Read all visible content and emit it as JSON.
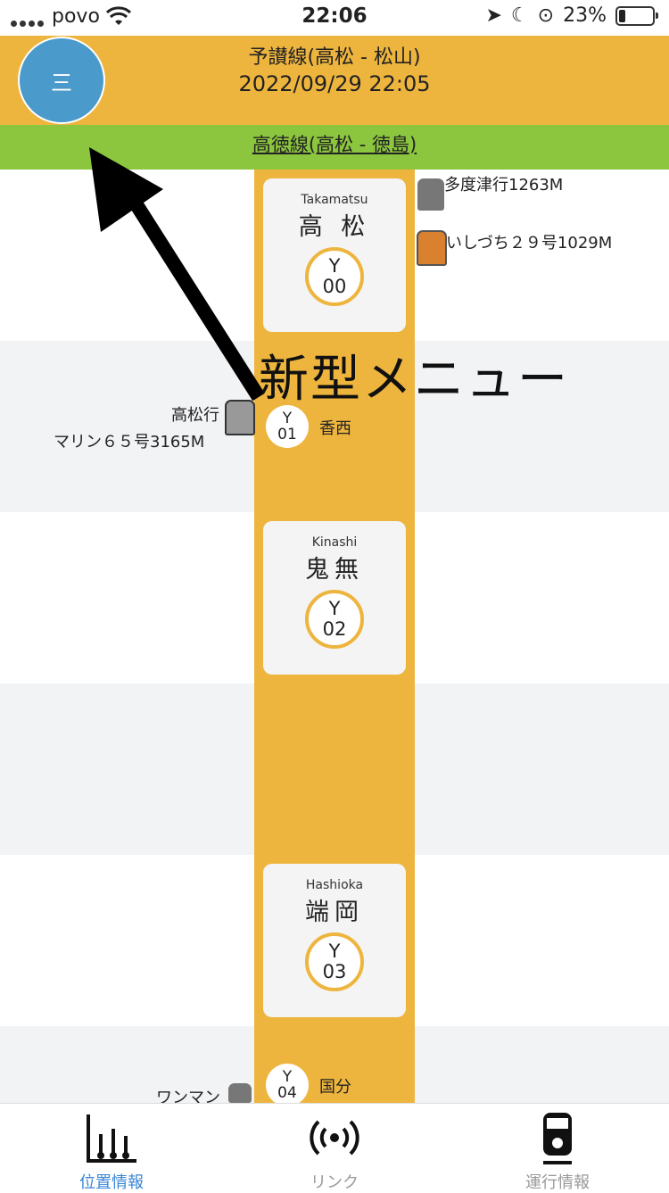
{
  "status_bar": {
    "carrier": "povo",
    "time": "22:06",
    "battery": "23%"
  },
  "header": {
    "line_name": "予讃線(高松 - 松山)",
    "datetime": "2022/09/29 22:05",
    "menu_button": "三",
    "sub_line": "高徳線(高松 - 徳島)"
  },
  "overlay": {
    "annotation": "新型メニュー"
  },
  "stations": [
    {
      "en": "Takamatsu",
      "jp": "高 松",
      "code_letter": "Y",
      "code_num": "00"
    },
    {
      "en": "Kinashi",
      "jp": "鬼無",
      "code_letter": "Y",
      "code_num": "02"
    },
    {
      "en": "Hashioka",
      "jp": "端岡",
      "code_letter": "Y",
      "code_num": "03"
    }
  ],
  "small_stations": [
    {
      "code_letter": "Y",
      "code_num": "01",
      "name": "香西"
    },
    {
      "code_letter": "Y",
      "code_num": "04",
      "name": "国分"
    }
  ],
  "trains": [
    {
      "label": "多度津行1263M"
    },
    {
      "label": "いしづち２９号1029M"
    },
    {
      "label_line1": "高松行",
      "label_line2": "マリン６５号3165M"
    },
    {
      "label": "ワンマン"
    }
  ],
  "tabs": [
    {
      "label": "位置情報",
      "icon": "chart-bars-icon",
      "active": true
    },
    {
      "label": "リンク",
      "icon": "broadcast-icon",
      "active": false
    },
    {
      "label": "運行情報",
      "icon": "train-icon",
      "active": false
    }
  ],
  "colors": {
    "yosan_line": "#EEB53E",
    "kotoku_line": "#8CC63F",
    "menu_button": "#4A9ACC",
    "active_tab": "#3A86D6"
  }
}
